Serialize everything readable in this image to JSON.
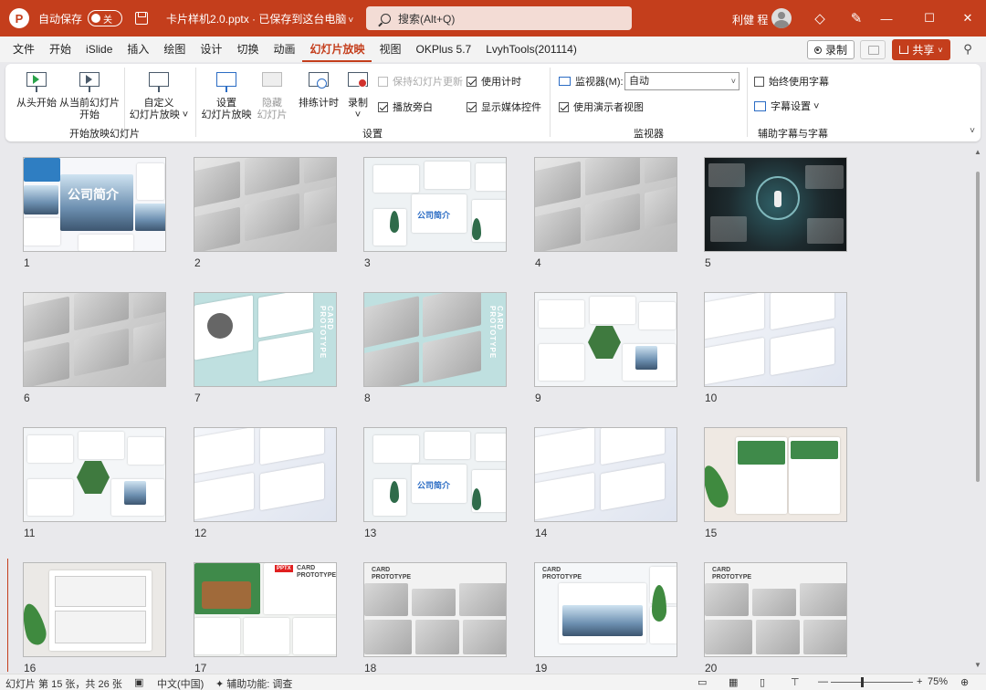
{
  "titlebar": {
    "logo_letter": "P",
    "autosave_label": "自动保存",
    "autosave_state": "关",
    "doc_title": "卡片样机2.0.pptx · 已保存到这台电脑",
    "search_placeholder": "搜索(Alt+Q)",
    "user_name": "利健 程",
    "controls": {
      "minimize": "—",
      "maximize": "☐",
      "close": "✕"
    }
  },
  "menu": {
    "tabs": [
      "文件",
      "开始",
      "iSlide",
      "插入",
      "绘图",
      "设计",
      "切换",
      "动画",
      "幻灯片放映",
      "视图",
      "OKPlus 5.7",
      "LvyhTools(201114)"
    ],
    "active_tab": "幻灯片放映",
    "record_label": "录制",
    "share_label": "共享"
  },
  "ribbon": {
    "groups": {
      "start_show": {
        "label": "开始放映幻灯片",
        "buttons": [
          {
            "label": "从头开始"
          },
          {
            "label1": "从当前幻灯片",
            "label2": "开始"
          },
          {
            "label1": "自定义",
            "label2": "幻灯片放映 ˅"
          }
        ]
      },
      "setup": {
        "label": "设置",
        "buttons": [
          {
            "label1": "设置",
            "label2": "幻灯片放映"
          },
          {
            "label1": "隐藏",
            "label2": "幻灯片"
          },
          {
            "label": "排练计时"
          },
          {
            "label1": "录制",
            "label2": "˅"
          }
        ],
        "checkboxes": [
          {
            "label": "保持幻灯片更新",
            "checked": false,
            "disabled": true
          },
          {
            "label": "使用计时",
            "checked": true,
            "disabled": false
          },
          {
            "label": "播放旁白",
            "checked": true,
            "disabled": false
          },
          {
            "label": "显示媒体控件",
            "checked": true,
            "disabled": false
          }
        ]
      },
      "monitors": {
        "label": "监视器",
        "monitor_label": "监视器(M):",
        "monitor_value": "自动",
        "presenter_view_label": "使用演示者视图",
        "presenter_view_checked": true
      },
      "captions": {
        "label": "辅助字幕与字幕",
        "always_subtitles_label": "始终使用字幕",
        "always_subtitles_checked": false,
        "subtitle_settings_label": "字幕设置 ˅"
      }
    }
  },
  "slides": [
    {
      "num": "1",
      "style": "mountain"
    },
    {
      "num": "2",
      "style": "gray"
    },
    {
      "num": "3",
      "style": "company"
    },
    {
      "num": "4",
      "style": "gray"
    },
    {
      "num": "5",
      "style": "dark"
    },
    {
      "num": "6",
      "style": "gray"
    },
    {
      "num": "7",
      "style": "teal"
    },
    {
      "num": "8",
      "style": "teal-gray"
    },
    {
      "num": "9",
      "style": "hex"
    },
    {
      "num": "10",
      "style": "white"
    },
    {
      "num": "11",
      "style": "hex"
    },
    {
      "num": "12",
      "style": "white"
    },
    {
      "num": "13",
      "style": "company"
    },
    {
      "num": "14",
      "style": "white"
    },
    {
      "num": "15",
      "style": "menu"
    },
    {
      "num": "16",
      "style": "book"
    },
    {
      "num": "17",
      "style": "green"
    },
    {
      "num": "18",
      "style": "gray-card"
    },
    {
      "num": "19",
      "style": "city"
    },
    {
      "num": "20",
      "style": "gray-card"
    }
  ],
  "slide_text": {
    "card_vertical": "CARD PROTOTYPE",
    "card_line1": "CARD",
    "card_line2": "PROTOTYPE",
    "pptx": "PPTX",
    "company_intro": "公司简介"
  },
  "statusbar": {
    "slide_info": "幻灯片 第 15 张，共 26 张",
    "language": "中文(中国)",
    "accessibility": "辅助功能: 调查",
    "zoom_minus": "—",
    "zoom_plus": "+",
    "zoom_percent": "75%",
    "zoom_level": 0.75
  },
  "colors": {
    "accent": "#c43e1c",
    "check_blue": "#2b6cc4"
  }
}
